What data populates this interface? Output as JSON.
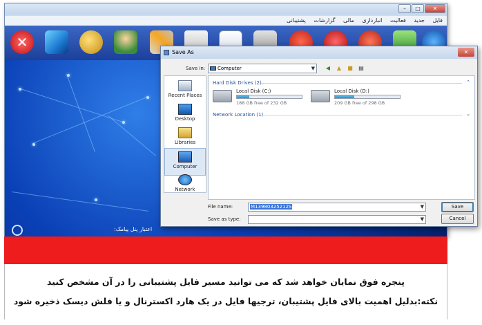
{
  "app": {
    "menu": [
      "فایل",
      "جدید",
      "فعالیت",
      "انبارداری",
      "مالی",
      "گزارشات",
      "پشتیبانی"
    ],
    "sms_credit_label": "اعتبار پنل پیامک:"
  },
  "save_dialog": {
    "title": "Save As",
    "save_in_label": "Save in:",
    "save_in_value": "Computer",
    "places": [
      "Recent Places",
      "Desktop",
      "Libraries",
      "Computer",
      "Network"
    ],
    "groups": {
      "hard_disks": "Hard Disk Drives (2)",
      "network": "Network Location (1)"
    },
    "drives": [
      {
        "name": "Local Disk (C:)",
        "free": "188 GB free of 232 GB",
        "used_fraction": 0.19
      },
      {
        "name": "Local Disk (D:)",
        "free": "209 GB free of 298 GB",
        "used_fraction": 0.3
      }
    ],
    "file_name_label": "File name:",
    "file_name_value": "M13980325212S",
    "save_as_type_label": "Save as type:",
    "save_as_type_value": "",
    "save_button": "Save",
    "cancel_button": "Cancel"
  },
  "instructions": {
    "line1": "پنجره فوق نمایان خواهد شد که می توانید مسیر فایل پشتیبانی را در آن مشخص کنید",
    "line2": "نکته:بدلیل اهمیت بالای فایل پشتیبان، ترجیها فایل در یک هارد اکسترنال و یا فلش دیسک ذخیره شود"
  },
  "colors": {
    "red_bar": "#ee1c1c",
    "toolbar": "#1c3f9a",
    "dialog_bg": "#f0f0f0"
  }
}
